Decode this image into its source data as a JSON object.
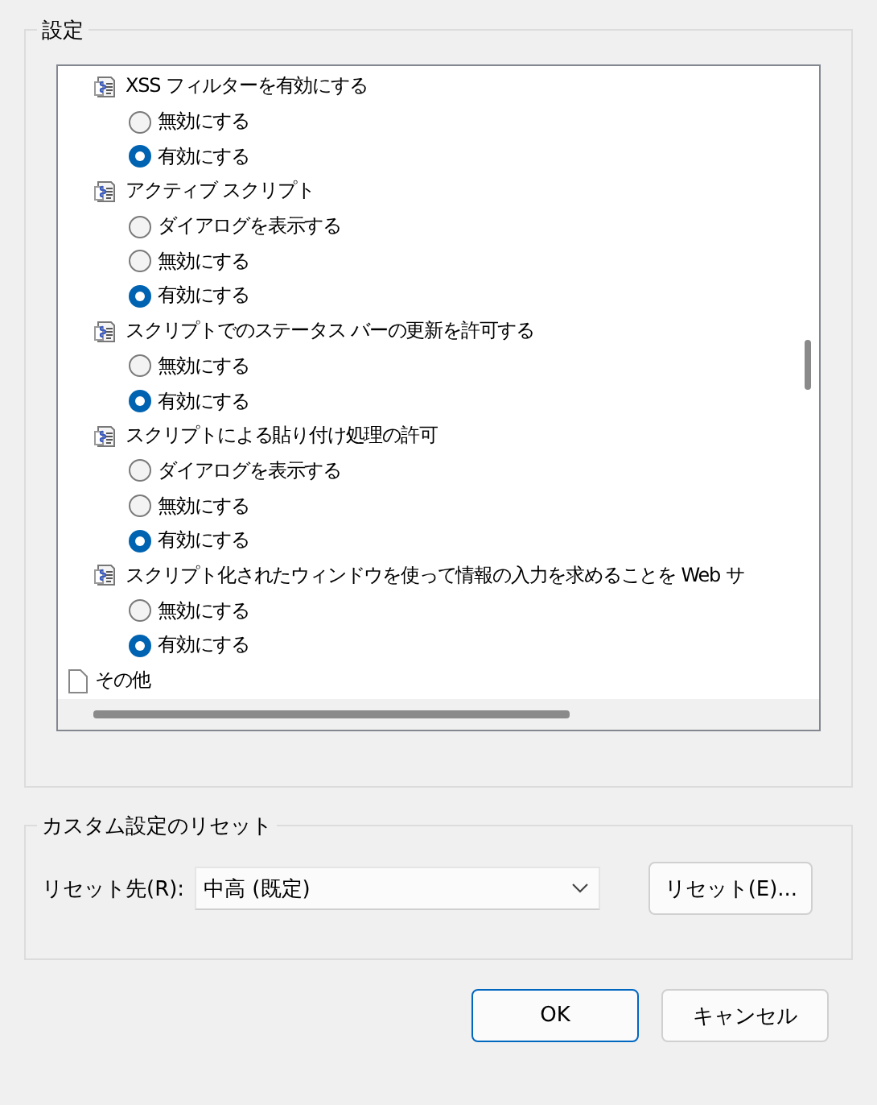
{
  "settings_group": {
    "title": "設定",
    "items": [
      {
        "kind": "setting",
        "label": "XSS フィルターを有効にする",
        "options": [
          {
            "label": "無効にする",
            "selected": false
          },
          {
            "label": "有効にする",
            "selected": true
          }
        ]
      },
      {
        "kind": "setting",
        "label": "アクティブ スクリプト",
        "options": [
          {
            "label": "ダイアログを表示する",
            "selected": false
          },
          {
            "label": "無効にする",
            "selected": false
          },
          {
            "label": "有効にする",
            "selected": true
          }
        ]
      },
      {
        "kind": "setting",
        "label": "スクリプトでのステータス バーの更新を許可する",
        "options": [
          {
            "label": "無効にする",
            "selected": false
          },
          {
            "label": "有効にする",
            "selected": true
          }
        ]
      },
      {
        "kind": "setting",
        "label": "スクリプトによる貼り付け処理の許可",
        "options": [
          {
            "label": "ダイアログを表示する",
            "selected": false
          },
          {
            "label": "無効にする",
            "selected": false
          },
          {
            "label": "有効にする",
            "selected": true
          }
        ]
      },
      {
        "kind": "setting",
        "label": "スクリプト化されたウィンドウを使って情報の入力を求めることを Web サ",
        "options": [
          {
            "label": "無効にする",
            "selected": false
          },
          {
            "label": "有効にする",
            "selected": true
          }
        ]
      },
      {
        "kind": "category",
        "label": "その他"
      }
    ]
  },
  "reset_group": {
    "title": "カスタム設定のリセット",
    "label": "リセット先(R):",
    "dropdown": {
      "value": "中高 (既定)"
    },
    "button": "リセット(E)..."
  },
  "buttons": [
    {
      "label": "OK",
      "kind": "default"
    },
    {
      "label": "キャンセル",
      "kind": "normal"
    }
  ]
}
